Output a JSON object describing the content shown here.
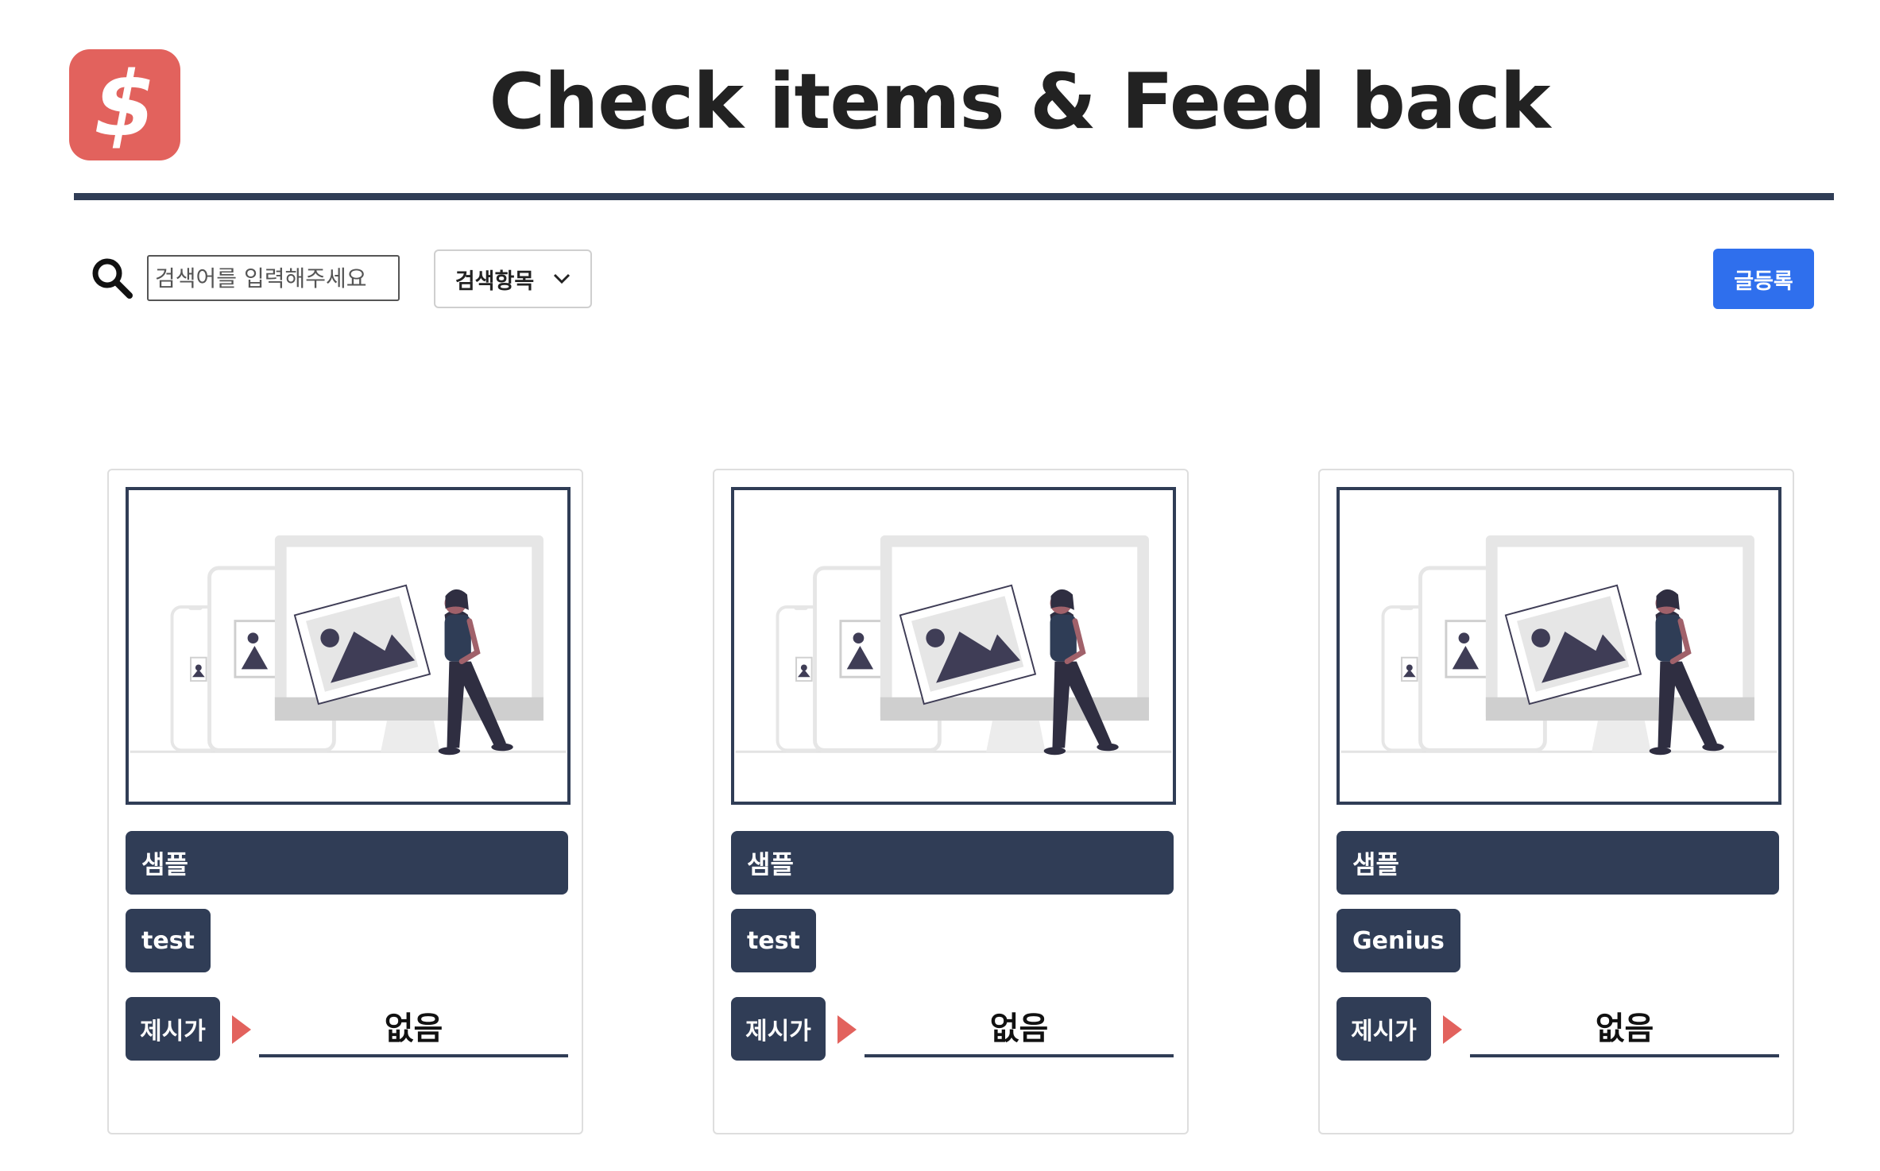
{
  "header": {
    "logo_symbol": "$",
    "title": "Check items & Feed back"
  },
  "search": {
    "placeholder": "검색어를 입력해주세요",
    "select_label": "검색항목",
    "write_button": "글등록"
  },
  "colors": {
    "navy": "#303d56",
    "accent_red": "#e2625d",
    "button_blue": "#2f6fed"
  },
  "cards": [
    {
      "title": "샘플",
      "tag": "test",
      "price_label": "제시가",
      "price_value": "없음"
    },
    {
      "title": "샘플",
      "tag": "test",
      "price_label": "제시가",
      "price_value": "없음"
    },
    {
      "title": "샘플",
      "tag": "Genius",
      "price_label": "제시가",
      "price_value": "없음"
    }
  ]
}
